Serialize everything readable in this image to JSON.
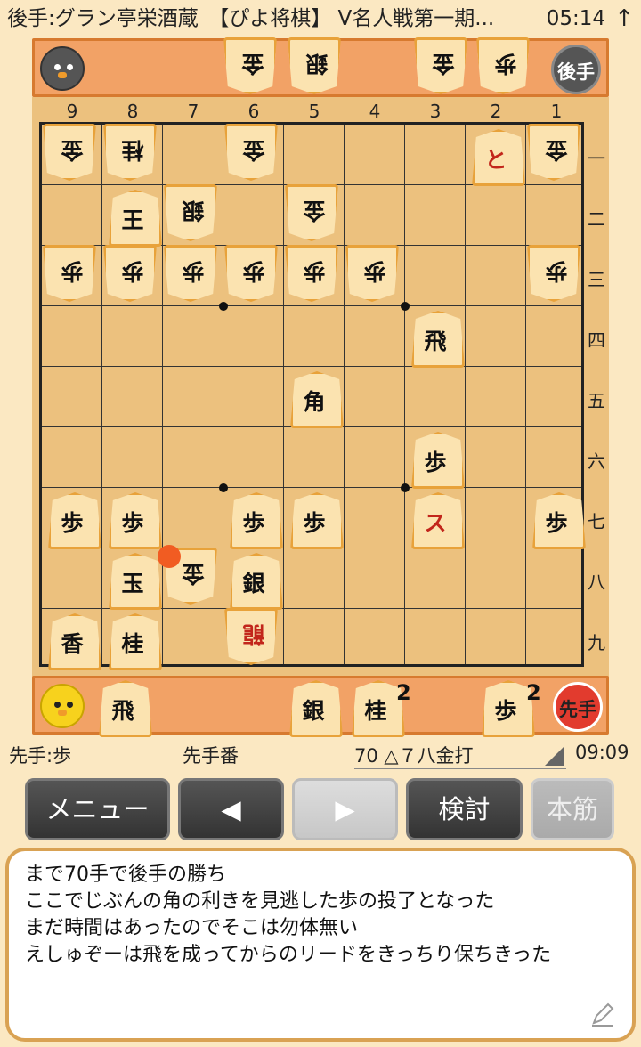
{
  "status_bar": {
    "title": "後手:グラン亭栄酒蔵　【ぴよ将棋】 V名人戦第一期...",
    "clock": "05:14",
    "arrow_icon": "up-arrow-icon"
  },
  "gote_hand": {
    "label": "後手",
    "pieces": [
      "金",
      "銀",
      "金",
      "歩"
    ]
  },
  "sente_hand": {
    "label": "先手",
    "pieces": [
      {
        "kanji": "飛",
        "count": ""
      },
      {
        "kanji": "銀",
        "count": ""
      },
      {
        "kanji": "桂",
        "count": "2"
      },
      {
        "kanji": "歩",
        "count": "2"
      }
    ]
  },
  "board": {
    "files": [
      "9",
      "8",
      "7",
      "6",
      "5",
      "4",
      "3",
      "2",
      "1"
    ],
    "ranks": [
      "一",
      "二",
      "三",
      "四",
      "五",
      "六",
      "七",
      "八",
      "九"
    ],
    "pieces": [
      {
        "file": 9,
        "rank": 1,
        "kanji": "金",
        "owner": "gote"
      },
      {
        "file": 8,
        "rank": 1,
        "kanji": "桂",
        "owner": "gote"
      },
      {
        "file": 6,
        "rank": 1,
        "kanji": "金",
        "owner": "gote"
      },
      {
        "file": 2,
        "rank": 1,
        "kanji": "と",
        "owner": "sente",
        "promoted": true
      },
      {
        "file": 1,
        "rank": 1,
        "kanji": "金",
        "owner": "gote"
      },
      {
        "file": 8,
        "rank": 2,
        "kanji": "王",
        "owner": "sente"
      },
      {
        "file": 7,
        "rank": 2,
        "kanji": "銀",
        "owner": "gote"
      },
      {
        "file": 5,
        "rank": 2,
        "kanji": "金",
        "owner": "gote"
      },
      {
        "file": 9,
        "rank": 3,
        "kanji": "歩",
        "owner": "gote"
      },
      {
        "file": 8,
        "rank": 3,
        "kanji": "歩",
        "owner": "gote"
      },
      {
        "file": 7,
        "rank": 3,
        "kanji": "歩",
        "owner": "gote"
      },
      {
        "file": 6,
        "rank": 3,
        "kanji": "歩",
        "owner": "gote"
      },
      {
        "file": 5,
        "rank": 3,
        "kanji": "歩",
        "owner": "gote"
      },
      {
        "file": 4,
        "rank": 3,
        "kanji": "歩",
        "owner": "gote"
      },
      {
        "file": 1,
        "rank": 3,
        "kanji": "歩",
        "owner": "gote"
      },
      {
        "file": 3,
        "rank": 4,
        "kanji": "飛",
        "owner": "sente"
      },
      {
        "file": 5,
        "rank": 5,
        "kanji": "角",
        "owner": "sente"
      },
      {
        "file": 3,
        "rank": 6,
        "kanji": "歩",
        "owner": "sente"
      },
      {
        "file": 9,
        "rank": 7,
        "kanji": "歩",
        "owner": "sente"
      },
      {
        "file": 8,
        "rank": 7,
        "kanji": "歩",
        "owner": "sente"
      },
      {
        "file": 6,
        "rank": 7,
        "kanji": "歩",
        "owner": "sente"
      },
      {
        "file": 5,
        "rank": 7,
        "kanji": "歩",
        "owner": "sente"
      },
      {
        "file": 3,
        "rank": 7,
        "kanji": "ス",
        "owner": "sente",
        "promoted": true
      },
      {
        "file": 1,
        "rank": 7,
        "kanji": "歩",
        "owner": "sente"
      },
      {
        "file": 8,
        "rank": 8,
        "kanji": "玉",
        "owner": "sente"
      },
      {
        "file": 7,
        "rank": 8,
        "kanji": "金",
        "owner": "gote"
      },
      {
        "file": 6,
        "rank": 8,
        "kanji": "銀",
        "owner": "sente"
      },
      {
        "file": 9,
        "rank": 9,
        "kanji": "香",
        "owner": "sente"
      },
      {
        "file": 8,
        "rank": 9,
        "kanji": "桂",
        "owner": "sente"
      },
      {
        "file": 6,
        "rank": 9,
        "kanji": "龍",
        "owner": "gote",
        "promoted": true
      }
    ],
    "last_move": {
      "file": 7,
      "rank": 8
    },
    "colors": {
      "board": "#ecc17e",
      "accent_dot": "#f15c22",
      "hand_bar": "#f2a266"
    }
  },
  "info": {
    "sente_hand_text": "先手:歩",
    "turn_text": "先手番",
    "move_text": "70 △７八金打",
    "time": "09:09"
  },
  "buttons": {
    "menu": "メニュー",
    "back": "◀",
    "forward": "▶",
    "kento": "検討",
    "honsuji": "本筋"
  },
  "comment": {
    "lines": [
      "まで70手で後手の勝ち",
      "ここでじぶんの角の利きを見逃した歩の投了となった",
      "まだ時間はあったのでそこは勿体無い",
      "えしゅぞーは飛を成ってからのリードをきっちり保ちきった"
    ],
    "edit_icon": "pencil-edit-icon"
  }
}
